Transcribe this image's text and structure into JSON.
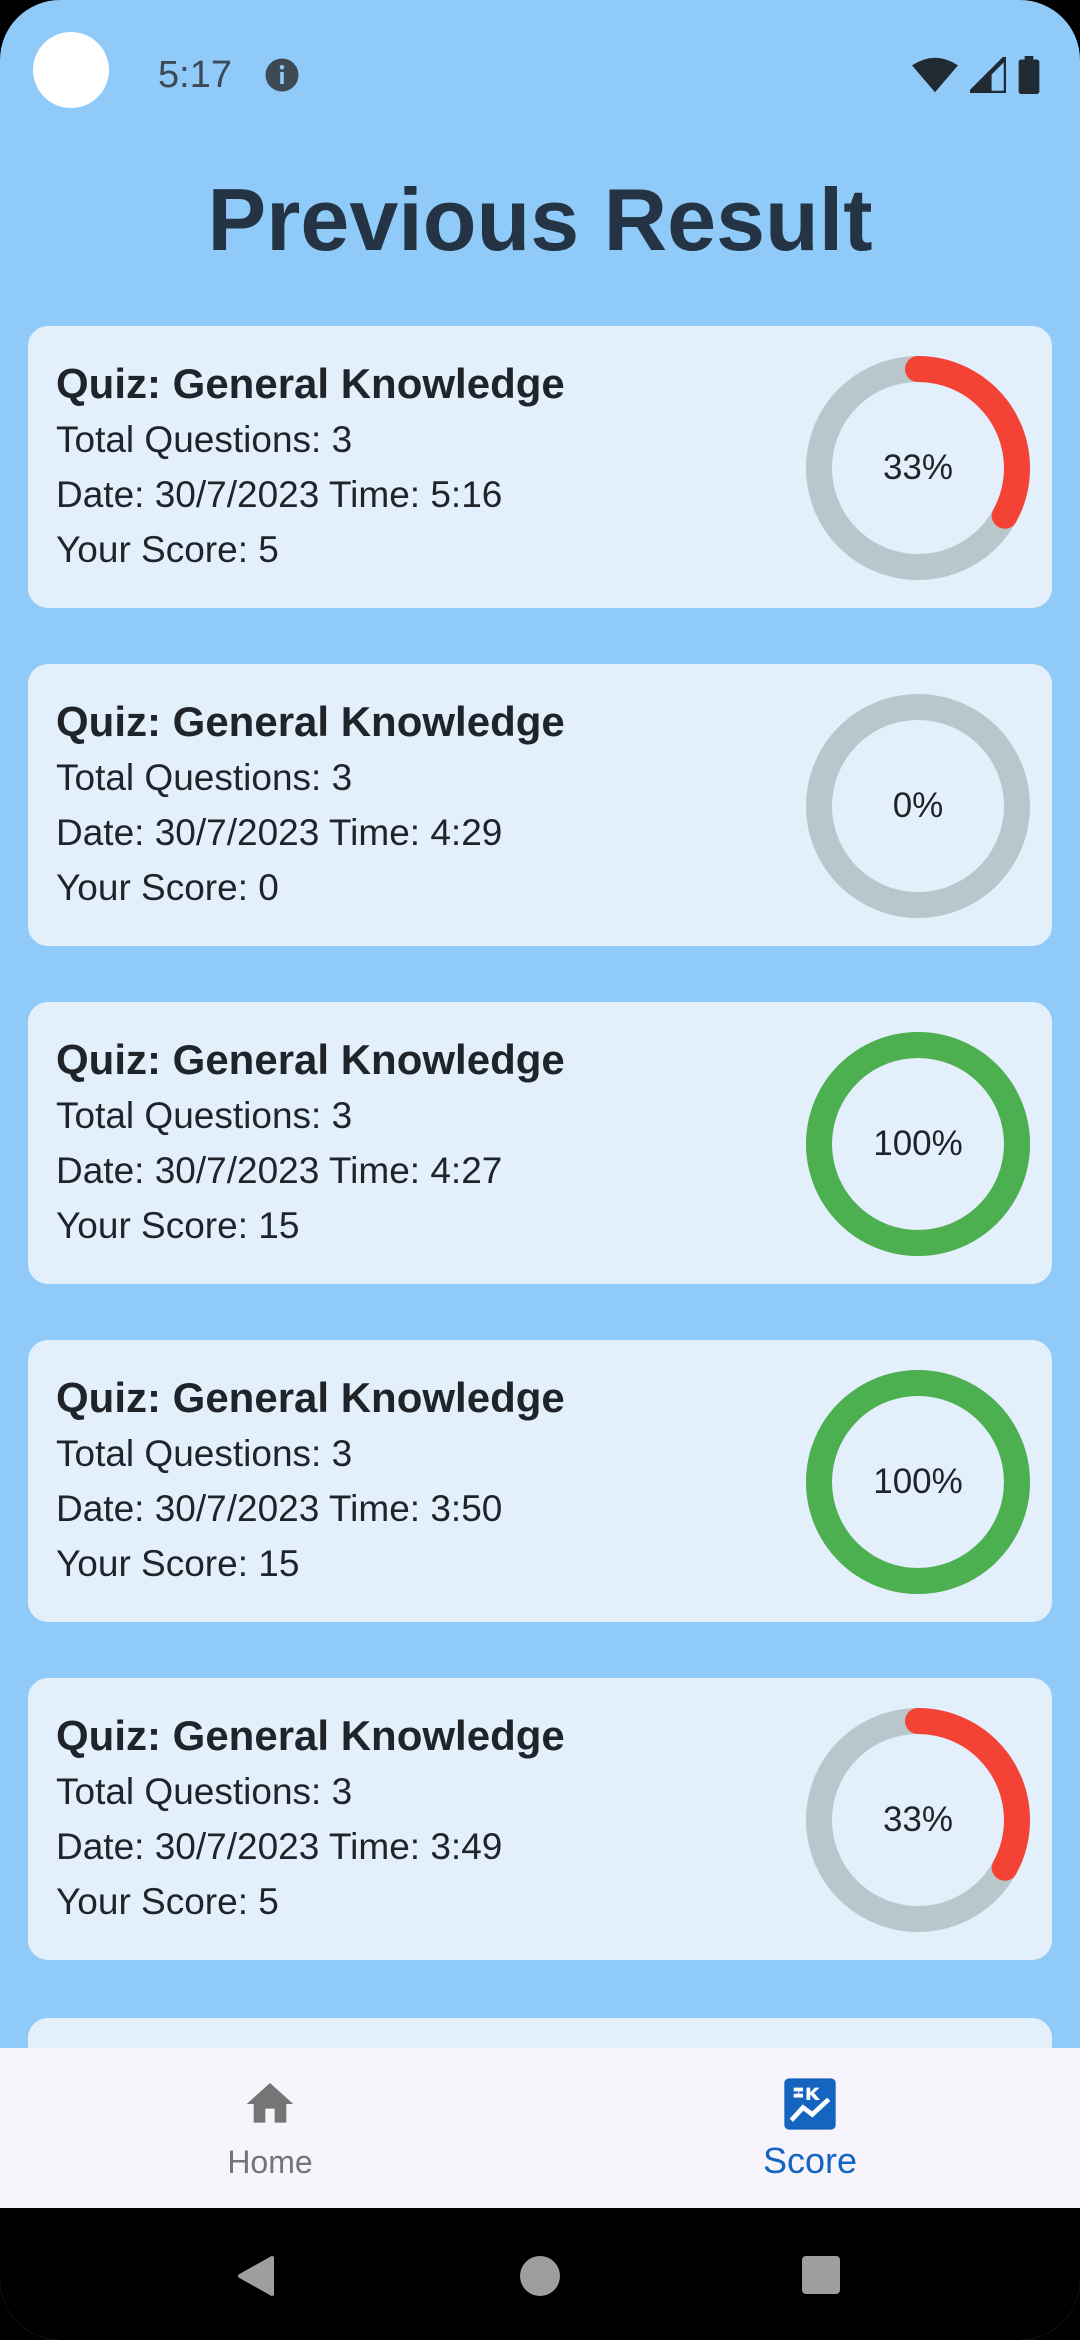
{
  "status_bar": {
    "time": "5:17",
    "icons": [
      "info-icon",
      "wifi-icon",
      "signal-icon",
      "battery-icon"
    ]
  },
  "page": {
    "title": "Previous Result"
  },
  "results": [
    {
      "title": "Quiz: General Knowledge",
      "total_questions": "Total Questions: 3",
      "datetime": "Date: 30/7/2023 Time: 5:16",
      "score": "Your Score: 5",
      "percent_label": "33%",
      "percent": 33
    },
    {
      "title": "Quiz: General Knowledge",
      "total_questions": "Total Questions: 3",
      "datetime": "Date: 30/7/2023 Time: 4:29",
      "score": "Your Score: 0",
      "percent_label": "0%",
      "percent": 0
    },
    {
      "title": "Quiz: General Knowledge",
      "total_questions": "Total Questions: 3",
      "datetime": "Date: 30/7/2023 Time: 4:27",
      "score": "Your Score: 15",
      "percent_label": "100%",
      "percent": 100
    },
    {
      "title": "Quiz: General Knowledge",
      "total_questions": "Total Questions: 3",
      "datetime": "Date: 30/7/2023 Time: 3:50",
      "score": "Your Score: 15",
      "percent_label": "100%",
      "percent": 100
    },
    {
      "title": "Quiz: General Knowledge",
      "total_questions": "Total Questions: 3",
      "datetime": "Date: 30/7/2023 Time: 3:49",
      "score": "Your Score: 5",
      "percent_label": "33%",
      "percent": 33
    }
  ],
  "colors": {
    "background": "#90CAF9",
    "card": "#E3F0FB",
    "ring_track": "#B9C7CC",
    "ring_low": "#F44336",
    "ring_full": "#4CAF50",
    "nav_active": "#1565C0",
    "nav_inactive": "#757575"
  },
  "bottom_nav": {
    "items": [
      {
        "label": "Home",
        "icon": "home-icon",
        "active": false
      },
      {
        "label": "Score",
        "icon": "score-chart-icon",
        "active": true
      }
    ]
  },
  "system_nav": {
    "icons": [
      "back-icon",
      "home-circle-icon",
      "recents-icon"
    ]
  }
}
